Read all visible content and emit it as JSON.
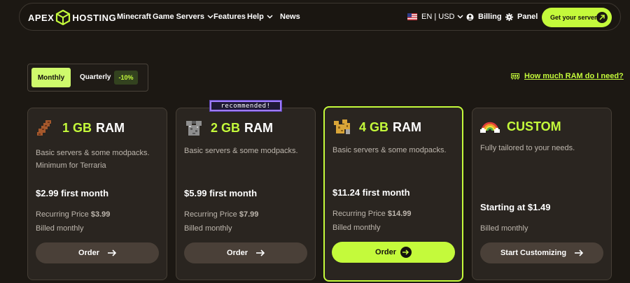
{
  "nav": {
    "logo_left": "APEX",
    "logo_right": "HOSTING",
    "links": [
      "Minecraft",
      "Game Servers",
      "Features",
      "Help",
      "News"
    ],
    "locale": "EN | USD",
    "billing": "Billing",
    "panel": "Panel",
    "cta": "Get your server"
  },
  "billing_toggle": {
    "monthly": "Monthly",
    "quarterly": "Quarterly",
    "quarterly_discount": "-10%"
  },
  "ram_help_link": "How much RAM do I need?",
  "recommended_badge": "recommended!",
  "plans": [
    {
      "size": "1 GB",
      "unit": "RAM",
      "icon": "leather-boot-icon",
      "description": "Basic servers & some modpacks. Minimum for Terraria",
      "price": "$2.99 first month",
      "recurring_label": "Recurring Price",
      "recurring_value": "$3.99",
      "billed": "Billed monthly",
      "button": "Order"
    },
    {
      "size": "2 GB",
      "unit": "RAM",
      "icon": "iron-chestplate-icon",
      "description": "Basic servers & some modpacks.",
      "price": "$5.99 first month",
      "recurring_label": "Recurring Price",
      "recurring_value": "$7.99",
      "billed": "Billed monthly",
      "button": "Order"
    },
    {
      "size": "4 GB",
      "unit": "RAM",
      "icon": "gold-armor-icon",
      "description": "Basic servers & some modpacks.",
      "price": "$11.24 first month",
      "recurring_label": "Recurring Price",
      "recurring_value": "$14.99",
      "billed": "Billed monthly",
      "button": "Order"
    },
    {
      "size": "CUSTOM",
      "icon": "rainbow-icon",
      "description": "Fully tailored to your needs.",
      "starting": "Starting at $1.49",
      "billed": "Billed monthly",
      "button": "Start Customizing"
    }
  ],
  "colors": {
    "accent": "#c4fa3b",
    "background": "#1c1813",
    "card": "#2a2520",
    "badge_border": "#9f7bff"
  }
}
